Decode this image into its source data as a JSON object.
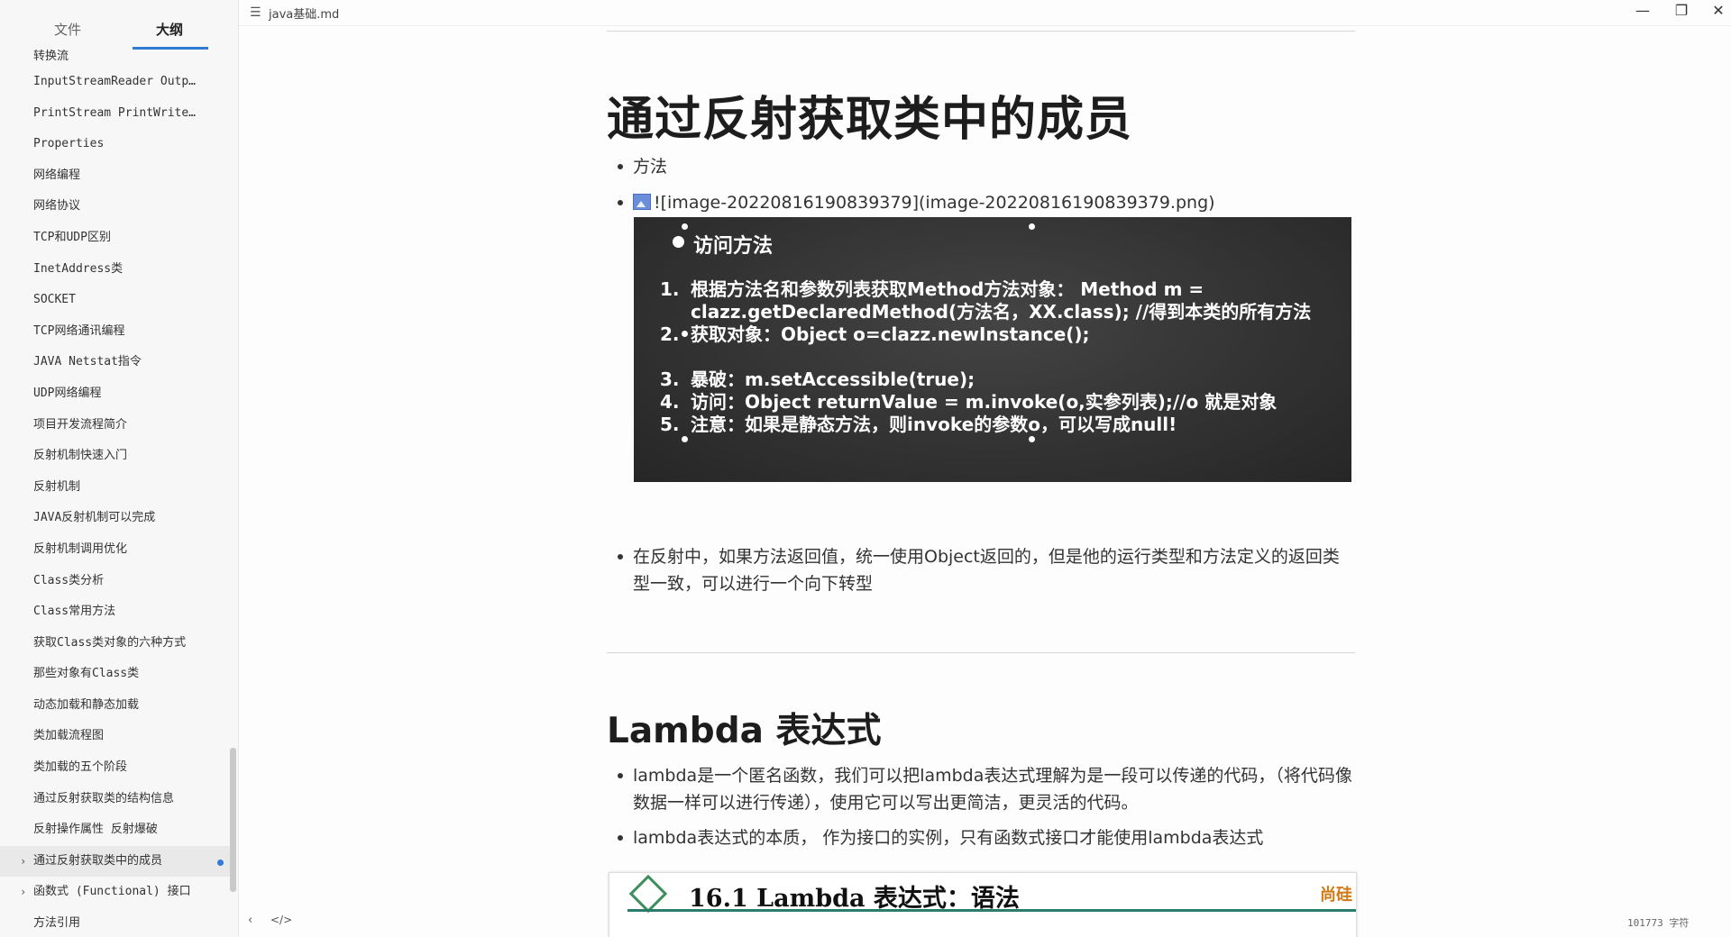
{
  "window": {
    "title": "java基础.md",
    "menu_icon": "hamburger-icon",
    "controls": [
      "—",
      "❐",
      "✕"
    ]
  },
  "sidebar": {
    "tabs": [
      {
        "label": "文件",
        "active": false
      },
      {
        "label": "大纲",
        "active": true
      }
    ],
    "items": [
      {
        "label": "转换流"
      },
      {
        "label": "InputStreamReader Outp…"
      },
      {
        "label": "PrintStream PrintWrite…"
      },
      {
        "label": "Properties"
      },
      {
        "label": "网络编程"
      },
      {
        "label": "网络协议"
      },
      {
        "label": "TCP和UDP区别"
      },
      {
        "label": "InetAddress类"
      },
      {
        "label": "SOCKET"
      },
      {
        "label": "TCP网络通讯编程"
      },
      {
        "label": "JAVA Netstat指令"
      },
      {
        "label": "UDP网络编程"
      },
      {
        "label": "项目开发流程简介"
      },
      {
        "label": "反射机制快速入门"
      },
      {
        "label": "反射机制"
      },
      {
        "label": "JAVA反射机制可以完成"
      },
      {
        "label": "反射机制调用优化"
      },
      {
        "label": "Class类分析"
      },
      {
        "label": "Class常用方法"
      },
      {
        "label": "获取Class类对象的六种方式"
      },
      {
        "label": "那些对象有Class类"
      },
      {
        "label": "动态加载和静态加载"
      },
      {
        "label": "类加载流程图"
      },
      {
        "label": "类加载的五个阶段"
      },
      {
        "label": "通过反射获取类的结构信息"
      },
      {
        "label": "反射操作属性 反射爆破"
      },
      {
        "label": "通过反射获取类中的成员",
        "chevron": "›",
        "active": true
      },
      {
        "label": "函数式 (Functional) 接口",
        "chevron": "›"
      },
      {
        "label": "方法引用"
      }
    ]
  },
  "content": {
    "h1": "通过反射获取类中的成员",
    "bullet_method": "方法",
    "image_markdown": "![image-20220816190839379](image-20220816190839379.png)",
    "board": {
      "heading": "访问方法",
      "lines": [
        {
          "num": "1.",
          "text": "根据方法名和参数列表获取Method方法对象： Method m = clazz.getDeclaredMethod(方法名，XX.class); //得到本类的所有方法"
        },
        {
          "num": "2.",
          "text": "获取对象：Object o=clazz.newInstance();"
        },
        {
          "num": "3.",
          "text": "暴破：m.setAccessible(true);"
        },
        {
          "num": "4.",
          "text": "访问：Object returnValue = m.invoke(o,实参列表);//o 就是对象"
        },
        {
          "num": "5.",
          "text": "注意：如果是静态方法，则invoke的参数o，可以写成null!"
        }
      ]
    },
    "bullet_reflection": "在反射中，如果方法返回值，统一使用Object返回的，但是他的运行类型和方法定义的返回类型一致，可以进行一个向下转型",
    "h2": "Lambda 表达式",
    "bullet_lambda1": "lambda是一个匿名函数，我们可以把lambda表达式理解为是一段可以传递的代码，（将代码像数据一样可以进行传递），使用它可以写出更简洁，更灵活的代码。",
    "bullet_lambda2": "lambda表达式的本质， 作为接口的实例，只有函数式接口才能使用lambda表达式",
    "lambda_slide_title": "16.1 Lambda 表达式：语法",
    "lambda_slide_brand": "尚硅"
  },
  "status": {
    "back_icon": "‹",
    "source_icon": "</>",
    "word_count": "101773 字符"
  }
}
